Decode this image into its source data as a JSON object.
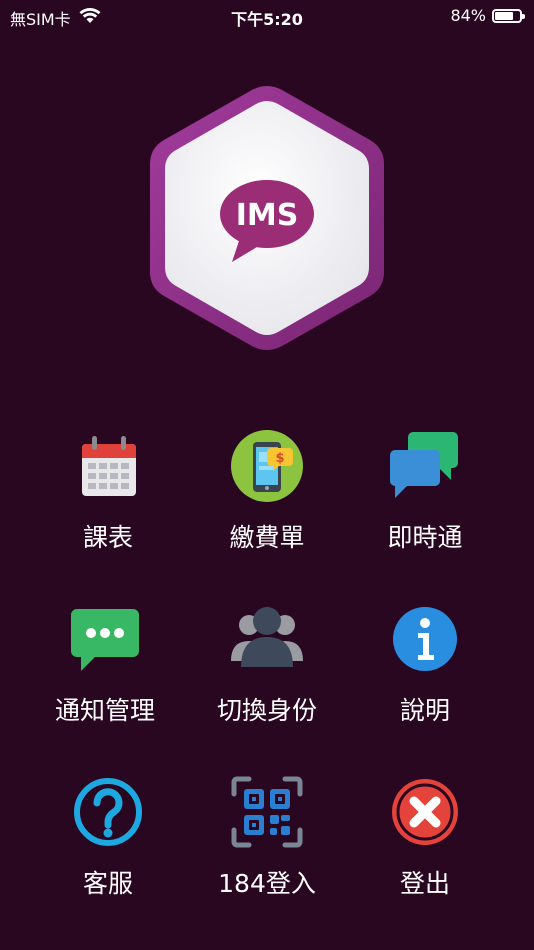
{
  "status_bar": {
    "carrier": "無SIM卡",
    "time": "下午5:20",
    "battery_percent": "84%",
    "battery_level": 0.84
  },
  "logo": {
    "text": "IMS",
    "icon": "speech-bubble-icon",
    "colors": {
      "frame": "#8e2e8a",
      "face": "#f4f4f6",
      "bubble": "#9b2c76"
    }
  },
  "menu": {
    "items": [
      {
        "label": "課表",
        "icon": "calendar-icon"
      },
      {
        "label": "繳費單",
        "icon": "mobile-payment-icon"
      },
      {
        "label": "即時通",
        "icon": "chat-bubbles-icon"
      },
      {
        "label": "通知管理",
        "icon": "notification-message-icon"
      },
      {
        "label": "切換身份",
        "icon": "switch-users-icon"
      },
      {
        "label": "說明",
        "icon": "info-icon"
      },
      {
        "label": "客服",
        "icon": "help-question-icon"
      },
      {
        "label": "184登入",
        "icon": "qr-code-icon"
      },
      {
        "label": "登出",
        "icon": "logout-close-icon"
      }
    ]
  },
  "colors": {
    "background": "#2a0721",
    "text": "#ffffff"
  }
}
